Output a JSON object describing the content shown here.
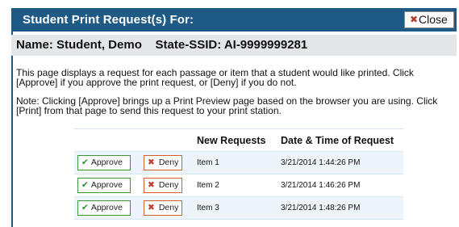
{
  "dialog": {
    "title": "Student Print Request(s) For:",
    "close_label": "Close",
    "close_icon": "close-x-icon"
  },
  "student": {
    "name_line": "Name: Student, Demo    State-SSID: AI-9999999281"
  },
  "instructions": {
    "paragraph1": "This page displays a request for each passage or item that a student would like printed. Click [Approve] if you approve the print request, or [Deny] if you do not.",
    "paragraph2": "Note: Clicking [Approve] brings up a Print Preview page based on the browser you are using. Click [Print] from that page to send this request to your print station."
  },
  "requests_table": {
    "headers": [
      "",
      "",
      "New Requests",
      "Date & Time of Request"
    ],
    "approve_label": "Approve",
    "deny_label": "Deny",
    "rows": [
      {
        "item": "Item 1",
        "datetime": "3/21/2014 1:44:26 PM"
      },
      {
        "item": "Item 2",
        "datetime": "3/21/2014 1:46:26 PM"
      },
      {
        "item": "Item 3",
        "datetime": "3/21/2014 1:48:26 PM"
      }
    ]
  },
  "colors": {
    "titlebar": "#1e5a85",
    "namebar": "#e3e6e9",
    "approve_accent": "#2e8b2e",
    "deny_accent": "#c0392b",
    "row_alt": "#eef5fa"
  }
}
